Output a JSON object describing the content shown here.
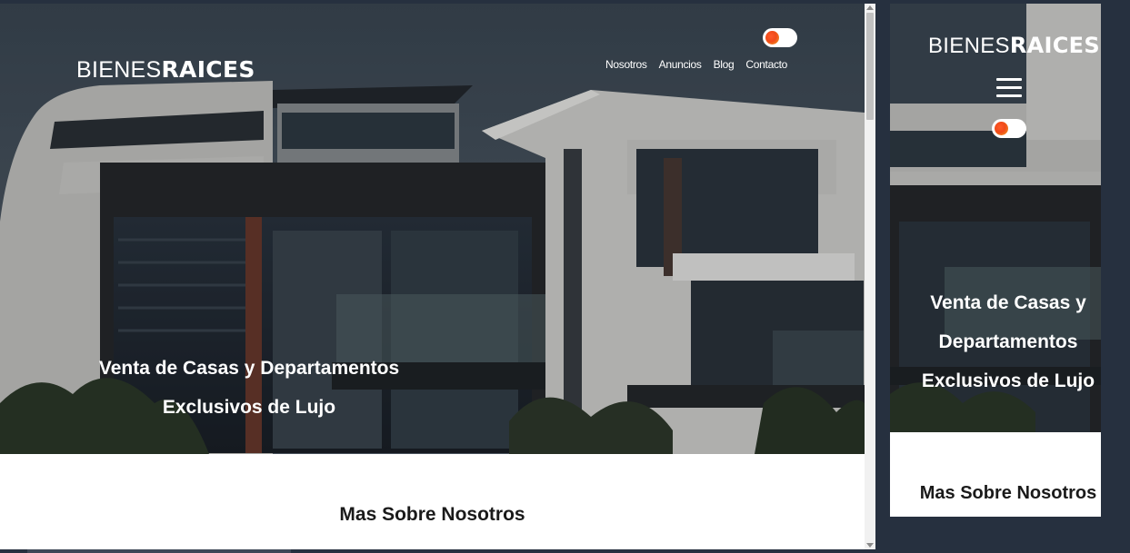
{
  "desktop": {
    "logo": {
      "light": "BIENES",
      "bold": "RAICES"
    },
    "nav": [
      "Nosotros",
      "Anuncios",
      "Blog",
      "Contacto"
    ],
    "hero_title": {
      "line1": "Venta de Casas y Departamentos",
      "line2": "Exclusivos de Lujo"
    },
    "section_title": "Mas Sobre Nosotros"
  },
  "mobile": {
    "logo": {
      "light": "BIENES",
      "bold": "RAICES"
    },
    "hero_title": {
      "line1": "Venta de Casas y",
      "line2": "Departamentos",
      "line3": "Exclusivos de Lujo"
    },
    "section_title": "Mas Sobre Nosotros"
  },
  "icons": {
    "dark_mode_toggle": "toggle-switch-icon",
    "menu": "hamburger-menu-icon"
  },
  "colors": {
    "page_background": "#26303f",
    "toggle_knob": "#f04a1a",
    "text_light": "#ffffff",
    "text_dark": "#1a1a1a"
  }
}
